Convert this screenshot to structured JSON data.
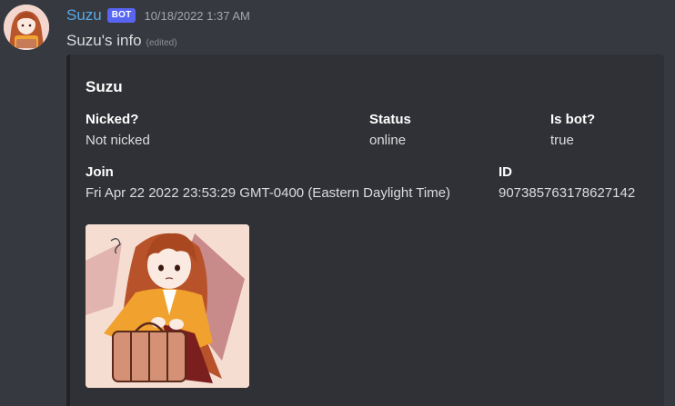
{
  "message": {
    "username": "Suzu",
    "bot_tag": "BOT",
    "timestamp": "10/18/2022 1:37 AM",
    "content": "Suzu's info",
    "edited": "(edited)"
  },
  "embed": {
    "title": "Suzu",
    "fields": {
      "nicked": {
        "name": "Nicked?",
        "value": "Not nicked"
      },
      "status": {
        "name": "Status",
        "value": "online"
      },
      "is_bot": {
        "name": "Is bot?",
        "value": "true"
      },
      "join": {
        "name": "Join",
        "value": "Fri Apr 22 2022 23:53:29 GMT-0400 (Eastern Daylight Time)"
      },
      "id": {
        "name": "ID",
        "value": "907385763178627142"
      }
    }
  },
  "colors": {
    "background": "#36393f",
    "embed_background": "#2f3136",
    "username": "#59a8e6",
    "bot_tag": "#5865f2"
  }
}
